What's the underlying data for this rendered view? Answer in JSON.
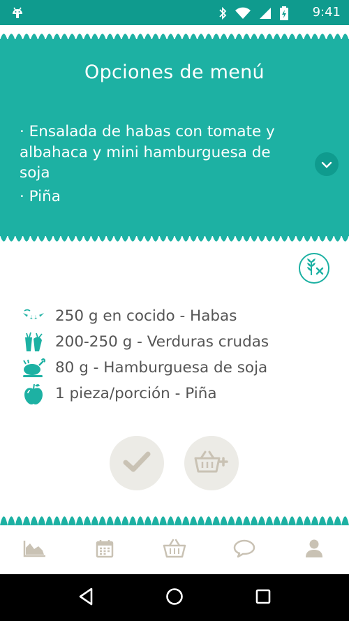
{
  "status_bar": {
    "time": "9:41",
    "icons": [
      "android-icon",
      "bluetooth-icon",
      "wifi-icon",
      "signal-icon",
      "battery-charging-icon"
    ]
  },
  "header": {
    "title": "Opciones de menú",
    "items": [
      "· Ensalada de habas con tomate y albahaca y mini hamburguesa de soja",
      "· Piña"
    ],
    "expand_icon": "chevron-down-icon"
  },
  "badge": {
    "icon": "gluten-free-icon"
  },
  "ingredients": [
    {
      "icon": "pea-pod-icon",
      "text": "250 g en cocido - Habas"
    },
    {
      "icon": "vegetables-icon",
      "text": "200-250 g - Verduras crudas"
    },
    {
      "icon": "roast-chicken-icon",
      "text": "80 g - Hamburguesa de soja"
    },
    {
      "icon": "apple-icon",
      "text": "1 pieza/porción - Piña"
    }
  ],
  "actions": [
    {
      "icon": "checkmark-icon"
    },
    {
      "icon": "basket-add-icon"
    }
  ],
  "tabs": [
    {
      "icon": "chart-area-icon"
    },
    {
      "icon": "calendar-icon"
    },
    {
      "icon": "basket-icon"
    },
    {
      "icon": "chat-bubble-icon"
    },
    {
      "icon": "user-icon"
    }
  ],
  "colors": {
    "primary": "#1db1a3",
    "primary_dark": "#0f9b8e",
    "text": "#555555",
    "icon_gray": "#c9c2b4",
    "button_bg": "#ecebe6"
  }
}
